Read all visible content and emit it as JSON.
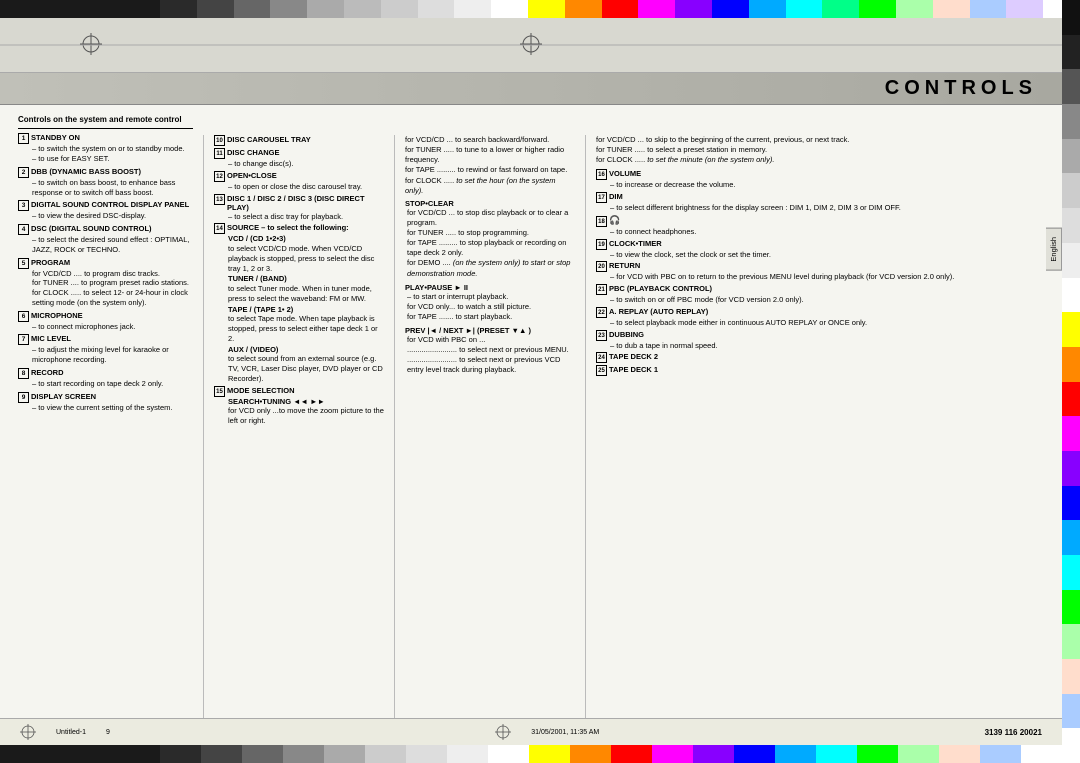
{
  "page": {
    "title": "CONTROLS",
    "page_number": "9",
    "document_ref": "3139 116 20021",
    "file_ref": "Untitled-1",
    "date": "31/05/2001, 11:35 AM"
  },
  "header": {
    "section_title": "Controls on the system and remote control"
  },
  "tab_label": "English",
  "colors": {
    "top_bar": [
      "#1a1a1a",
      "#2a2a2a",
      "#555555",
      "#888888",
      "#aaaaaa",
      "#cccccc",
      "#eeeeee",
      "#ffff00",
      "#ff8800",
      "#ff0000",
      "#ff00ff",
      "#0000ff",
      "#00ffff",
      "#00ff00",
      "#ffffff",
      "#ffccaa",
      "#aaddff",
      "#ccffcc"
    ]
  },
  "col1": {
    "items": [
      {
        "num": "1",
        "title": "STANDBY ON",
        "subs": [
          "to switch the system on or to standby mode.",
          "to use for EASY SET."
        ]
      },
      {
        "num": "2",
        "title": "DBB (DYNAMIC BASS BOOST)",
        "subs": [
          "to switch on bass boost, to enhance bass response or to switch off bass boost."
        ]
      },
      {
        "num": "3",
        "title": "DIGITAL SOUND CONTROL DISPLAY PANEL",
        "subs": [
          "to view the desired DSC-display."
        ]
      },
      {
        "num": "4",
        "title": "DSC (DIGITAL SOUND CONTROL)",
        "subs": [
          "to select the desired sound effect : OPTIMAL, JAZZ, ROCK or TECHNO."
        ]
      },
      {
        "num": "5",
        "title": "PROGRAM",
        "subs": [
          "for VCD/CD .... to program disc tracks.",
          "for TUNER .... to program preset radio stations.",
          "for CLOCK ..... to select 12- or 24-hour in clock setting mode (on the system only)."
        ]
      },
      {
        "num": "6",
        "title": "MICROPHONE",
        "subs": [
          "to connect microphones jack."
        ]
      },
      {
        "num": "7",
        "title": "MIC LEVEL",
        "subs": [
          "to adjust the mixing level for karaoke or microphone recording."
        ]
      },
      {
        "num": "8",
        "title": "RECORD",
        "subs": [
          "to start recording on tape deck 2 only."
        ]
      },
      {
        "num": "9",
        "title": "DISPLAY SCREEN",
        "subs": [
          "to view the current setting of the system."
        ]
      }
    ]
  },
  "col2": {
    "items": [
      {
        "num": "10",
        "title": "DISC CAROUSEL TRAY"
      },
      {
        "num": "11",
        "title": "DISC CHANGE",
        "subs": [
          "to change disc(s)."
        ]
      },
      {
        "num": "12",
        "title": "OPEN•CLOSE",
        "subs": [
          "to open or close the disc carousel tray."
        ]
      },
      {
        "num": "13",
        "title": "DISC 1 / DISC 2 / DISC 3 (DISC DIRECT PLAY)",
        "subs": [
          "to select a disc tray for playback."
        ]
      },
      {
        "num": "14",
        "title": "SOURCE – to select the following:",
        "sub_title2": "VCD / (CD 1•2•3)",
        "subs": [
          "to select VCD/CD mode. When VCD/CD playback is stopped, press to select the disc tray 1, 2 or 3."
        ],
        "sub_title3": "TUNER / (BAND)",
        "subs2": [
          "to select Tuner mode. When in tuner mode, press to select the waveband: FM or MW."
        ],
        "sub_title4": "TAPE / (TAPE 1• 2)",
        "subs3": [
          "to select Tape mode. When tape playback is stopped, press to select either tape deck 1 or 2."
        ],
        "sub_title5": "AUX / (VIDEO)",
        "subs4": [
          "to select sound from an external source (e.g. TV, VCR, Laser Disc player, DVD player or CD Recorder)."
        ]
      },
      {
        "num": "15",
        "title": "MODE SELECTION",
        "sub_title2": "SEARCH•TUNING ◄◄ ►►",
        "subs": [
          "for VCD only ...to move the zoom picture to the left or right."
        ]
      }
    ]
  },
  "col3": {
    "items": [
      {
        "label": "for VCD/CD ...",
        "text": "to search backward/forward."
      },
      {
        "label": "for TUNER .....",
        "text": "to tune to a lower or higher radio frequency."
      },
      {
        "label": "for TAPE .........",
        "text": "to rewind or fast forward on tape."
      },
      {
        "label": "for CLOCK .....",
        "text": "to set the hour (on the system only)."
      }
    ],
    "stop_clear": {
      "title": "STOP•CLEAR",
      "items": [
        {
          "label": "for VCD/CD ...",
          "text": "to stop disc playback or to clear a program."
        },
        {
          "label": "for TUNER .....",
          "text": "to stop programming."
        },
        {
          "label": "for TAPE .........",
          "text": "to stop playback or recording on tape deck 2 only."
        },
        {
          "label": "for DEMO ....",
          "text": "(on the system only) to start or stop demonstration mode."
        }
      ]
    },
    "play_pause": {
      "title": "PLAY•PAUSE ► II",
      "items": [
        {
          "label": "",
          "text": "to start or interrupt playback."
        },
        {
          "label": "for VCD only...",
          "text": "to watch a still picture."
        },
        {
          "label": "for TAPE .......",
          "text": "to start playback."
        }
      ]
    },
    "prev_next": {
      "title": "PREV |◄ / NEXT ►| (PRESET ▼▲ )",
      "items": [
        {
          "label": "",
          "text": "for VCD with PBC on ..."
        },
        {
          "label": "........................",
          "text": "to select next or previous MENU."
        },
        {
          "label": "........................",
          "text": "to select next or previous VCD entry level track during playback."
        }
      ]
    }
  },
  "col4": {
    "items": [
      {
        "label": "for VCD/CD ...",
        "text": "to skip to the beginning of the current, previous, or next track."
      },
      {
        "label": "for TUNER .....",
        "text": "to select a preset station in memory."
      },
      {
        "label": "for CLOCK .....",
        "text": "to set the minute (on the system only)."
      }
    ],
    "numbered": [
      {
        "num": "16",
        "title": "VOLUME",
        "subs": [
          "to increase or decrease the volume."
        ]
      },
      {
        "num": "17",
        "title": "DIM",
        "subs": [
          "to select different brightness for the display screen : DIM 1, DIM 2, DIM 3 or DIM OFF."
        ]
      },
      {
        "num": "18",
        "title": "🎧",
        "subs": [
          "to connect headphones."
        ]
      },
      {
        "num": "19",
        "title": "CLOCK•TIMER",
        "subs": [
          "to view the clock, set the clock or set the timer."
        ]
      },
      {
        "num": "20",
        "title": "RETURN",
        "subs": [
          "for VCD with PBC on to return to the previous MENU level during playback (for VCD version 2.0 only)."
        ]
      },
      {
        "num": "21",
        "title": "PBC (PLAYBACK CONTROL)",
        "subs": [
          "to switch on or off PBC mode (for VCD version 2.0 only)."
        ]
      },
      {
        "num": "22",
        "title": "A. REPLAY (AUTO REPLAY)",
        "subs": [
          "to select playback mode either in continuous AUTO REPLAY or ONCE only."
        ]
      },
      {
        "num": "23",
        "title": "DUBBING",
        "subs": [
          "to dub a tape in normal speed."
        ]
      },
      {
        "num": "24",
        "title": "TAPE DECK 2"
      },
      {
        "num": "25",
        "title": "TAPE DECK 1"
      }
    ]
  }
}
